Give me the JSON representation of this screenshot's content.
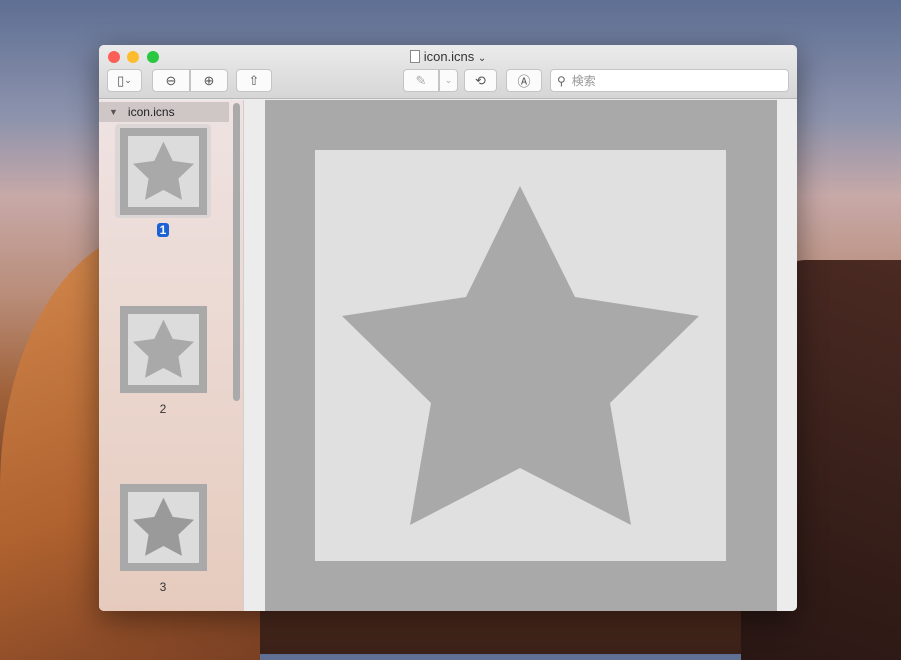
{
  "window": {
    "title": "icon.icns"
  },
  "toolbar": {
    "search_placeholder": "検索"
  },
  "sidebar": {
    "group": "icon.icns",
    "pages": [
      {
        "label": "1",
        "selected": true
      },
      {
        "label": "2"
      },
      {
        "label": "3"
      }
    ]
  },
  "colors": {
    "selection": "#1a62d6",
    "icon_bg": "#a9a9a9",
    "icon_inner": "#e0e0e0"
  }
}
